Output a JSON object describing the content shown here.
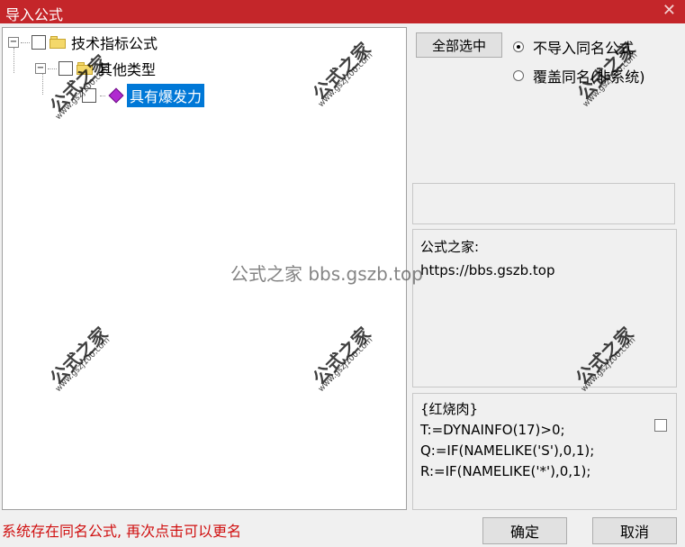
{
  "window": {
    "title": "导入公式",
    "close_symbol": "✕"
  },
  "tree": {
    "root": {
      "expander": "−",
      "label": "技术指标公式"
    },
    "child": {
      "expander": "−",
      "label": "其他类型"
    },
    "leaf": {
      "label": "具有爆发力"
    }
  },
  "controls": {
    "select_all": "全部选中",
    "radio_no_import": "不导入同名公式",
    "radio_overwrite": "覆盖同名(非系统)"
  },
  "info": {
    "line1": "公式之家:",
    "line2": "https://bbs.gszb.top"
  },
  "code": {
    "text": "{红烧肉}\nT:=DYNAINFO(17)>0;\nQ:=IF(NAMELIKE('S'),0,1);\nR:=IF(NAMELIKE('*'),0,1);"
  },
  "status_text": "系统存在同名公式, 再次点击可以更名",
  "buttons": {
    "ok": "确定",
    "cancel": "取消"
  },
  "watermark": {
    "big": "公式之家",
    "url": "www.gszj100.com",
    "center": "公式之家 bbs.gszb.top"
  }
}
